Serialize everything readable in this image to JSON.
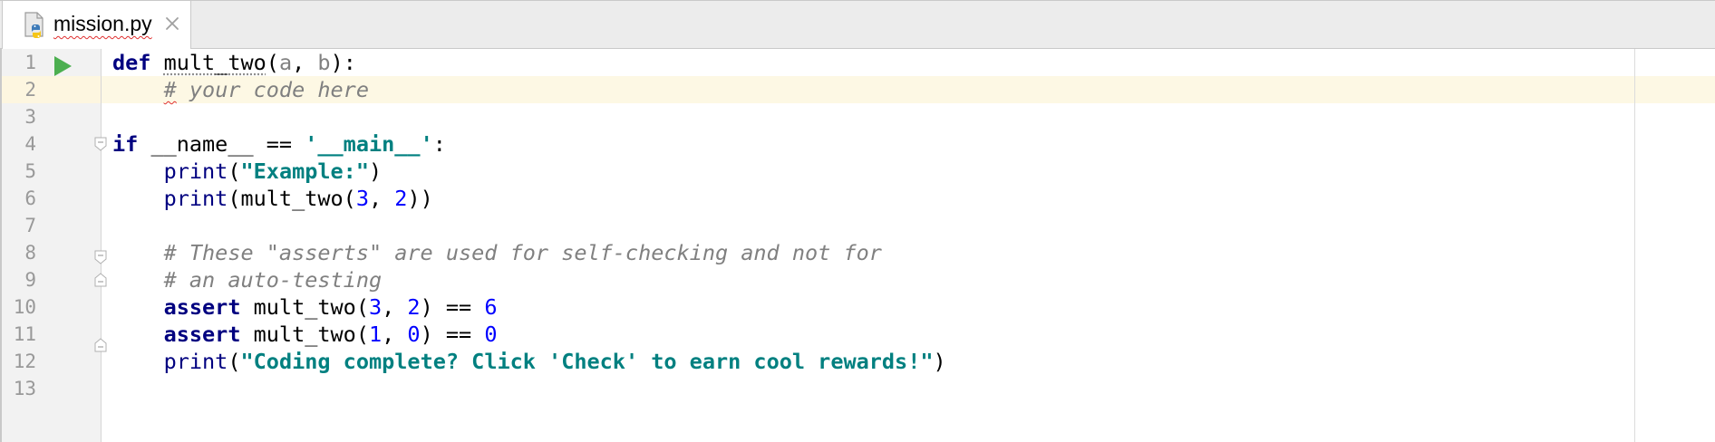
{
  "tab": {
    "filename": "mission.py",
    "icon": "python-file-icon",
    "close_icon": "close-icon"
  },
  "editor": {
    "line_numbers": [
      "1",
      "2",
      "3",
      "4",
      "5",
      "6",
      "7",
      "8",
      "9",
      "10",
      "11",
      "12",
      "13"
    ],
    "current_line": 2,
    "lines": [
      {
        "tokens": [
          {
            "t": "def",
            "c": "kw"
          },
          {
            "t": " "
          },
          {
            "t": "mult_two",
            "c": "weak-warn"
          },
          {
            "t": "("
          },
          {
            "t": "a",
            "c": "param"
          },
          {
            "t": ", "
          },
          {
            "t": "b",
            "c": "param"
          },
          {
            "t": "):"
          }
        ]
      },
      {
        "tokens": [
          {
            "t": "    "
          },
          {
            "t": "#",
            "c": "cmt typo"
          },
          {
            "t": " your code here",
            "c": "cmt"
          }
        ]
      },
      {
        "tokens": []
      },
      {
        "tokens": [
          {
            "t": "if",
            "c": "kw"
          },
          {
            "t": " __name__ == "
          },
          {
            "t": "'__main__'",
            "c": "str"
          },
          {
            "t": ":"
          }
        ]
      },
      {
        "tokens": [
          {
            "t": "    "
          },
          {
            "t": "print",
            "c": "builtin"
          },
          {
            "t": "("
          },
          {
            "t": "\"Example:\"",
            "c": "str"
          },
          {
            "t": ")"
          }
        ]
      },
      {
        "tokens": [
          {
            "t": "    "
          },
          {
            "t": "print",
            "c": "builtin"
          },
          {
            "t": "(mult_two("
          },
          {
            "t": "3",
            "c": "num"
          },
          {
            "t": ", "
          },
          {
            "t": "2",
            "c": "num"
          },
          {
            "t": "))"
          }
        ]
      },
      {
        "tokens": []
      },
      {
        "tokens": [
          {
            "t": "    "
          },
          {
            "t": "# These \"asserts\" are used for self-checking and not for",
            "c": "cmt"
          }
        ]
      },
      {
        "tokens": [
          {
            "t": "    "
          },
          {
            "t": "# an auto-testing",
            "c": "cmt"
          }
        ]
      },
      {
        "tokens": [
          {
            "t": "    "
          },
          {
            "t": "assert",
            "c": "kw"
          },
          {
            "t": " mult_two("
          },
          {
            "t": "3",
            "c": "num"
          },
          {
            "t": ", "
          },
          {
            "t": "2",
            "c": "num"
          },
          {
            "t": ") == "
          },
          {
            "t": "6",
            "c": "num"
          }
        ]
      },
      {
        "tokens": [
          {
            "t": "    "
          },
          {
            "t": "assert",
            "c": "kw"
          },
          {
            "t": " mult_two("
          },
          {
            "t": "1",
            "c": "num"
          },
          {
            "t": ", "
          },
          {
            "t": "0",
            "c": "num"
          },
          {
            "t": ") == "
          },
          {
            "t": "0",
            "c": "num"
          }
        ]
      },
      {
        "tokens": [
          {
            "t": "    "
          },
          {
            "t": "print",
            "c": "builtin"
          },
          {
            "t": "("
          },
          {
            "t": "\"Coding complete? Click 'Check' to earn cool rewards!\"",
            "c": "str"
          },
          {
            "t": ")"
          }
        ]
      },
      {
        "tokens": []
      }
    ],
    "run_icon": "run-icon",
    "fold_marker_icon": "fold-marker-icon",
    "colors": {
      "keyword": "#000080",
      "string": "#008080",
      "number": "#0000ff",
      "comment": "#808080",
      "caret_row": "#fdf8e4",
      "run_green": "#4caf50"
    }
  }
}
